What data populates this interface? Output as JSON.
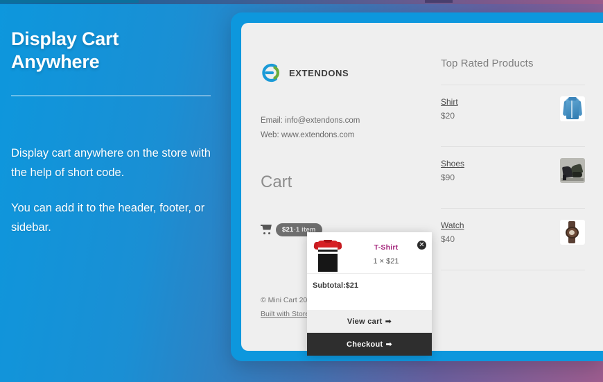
{
  "hero": {
    "headline": "Display Cart\nAnywhere",
    "paragraphs": [
      "Display cart anywhere on the store with the help of short code.",
      "You can add it to the header, footer, or sidebar."
    ]
  },
  "store": {
    "brand": {
      "name": "EXTENDONS",
      "logo_icon": "extendons-logo-icon"
    },
    "contact": {
      "email_line": "Email: info@extendons.com",
      "web_line": "Web: www.extendons.com"
    },
    "cart_heading": "Cart",
    "cart_trigger": {
      "icon": "shopping-cart-icon",
      "total": "$21",
      "separator": "-",
      "item_count": "1 item"
    },
    "footer": {
      "copyright": "© Mini Cart 2024",
      "built_with": "Built with Store"
    },
    "products_panel": {
      "title": "Top Rated Products",
      "items": [
        {
          "name": "Shirt",
          "price": "$20",
          "thumb": "shirt-thumbnail"
        },
        {
          "name": "Shoes",
          "price": "$90",
          "thumb": "shoes-thumbnail"
        },
        {
          "name": "Watch",
          "price": "$40",
          "thumb": "watch-thumbnail"
        }
      ]
    }
  },
  "mini_cart_popup": {
    "item": {
      "name": "T-Shirt",
      "quantity_line": "1 × $21",
      "thumb": "tshirt-thumbnail",
      "remove_icon": "close-circle-icon",
      "remove_glyph": "✕"
    },
    "subtotal_label": "Subtotal:$21",
    "view_cart_label": "View cart",
    "checkout_label": "Checkout",
    "arrow_glyph": "➡"
  },
  "colors": {
    "brand_blue": "#0d97dd",
    "accent_green": "#6aab3b",
    "product_link": "#a4267c",
    "checkout_bg": "#2e2e2e",
    "badge_bg": "#6e6e6e"
  }
}
